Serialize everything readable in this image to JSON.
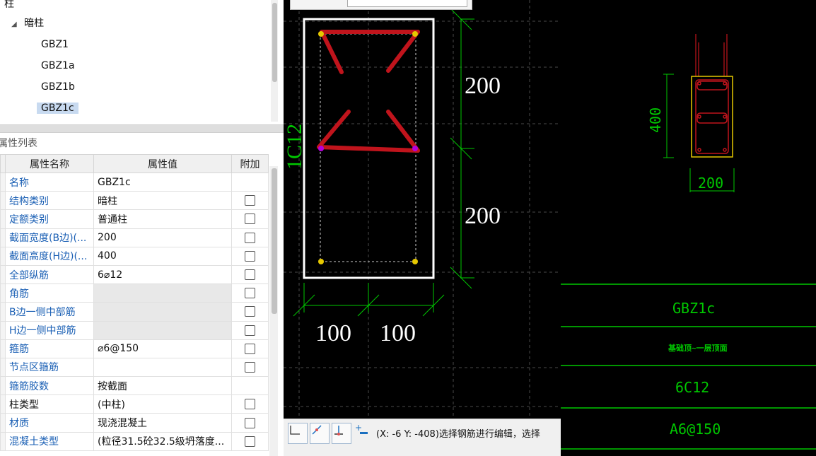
{
  "tree": {
    "root_label": "柱",
    "group_label": "暗柱",
    "items": [
      "GBZ1",
      "GBZ1a",
      "GBZ1b",
      "GBZ1c"
    ],
    "selected": "GBZ1c"
  },
  "props": {
    "title": "属性列表",
    "headers": [
      "属性名称",
      "属性值",
      "附加"
    ],
    "rows": [
      {
        "name": "名称",
        "value": "GBZ1c",
        "has_check": false,
        "grey": false,
        "black": false
      },
      {
        "name": "结构类别",
        "value": "暗柱",
        "has_check": true,
        "grey": false,
        "black": false
      },
      {
        "name": "定额类别",
        "value": "普通柱",
        "has_check": true,
        "grey": false,
        "black": false
      },
      {
        "name": "截面宽度(B边)(...",
        "value": "200",
        "has_check": true,
        "grey": false,
        "black": false
      },
      {
        "name": "截面高度(H边)(...",
        "value": "400",
        "has_check": true,
        "grey": false,
        "black": false
      },
      {
        "name": "全部纵筋",
        "value": "6⌀12",
        "has_check": true,
        "grey": false,
        "black": false
      },
      {
        "name": "角筋",
        "value": "",
        "has_check": true,
        "grey": true,
        "black": false
      },
      {
        "name": "B边一侧中部筋",
        "value": "",
        "has_check": true,
        "grey": true,
        "black": false
      },
      {
        "name": "H边一侧中部筋",
        "value": "",
        "has_check": true,
        "grey": true,
        "black": false
      },
      {
        "name": "箍筋",
        "value": "⌀6@150",
        "has_check": true,
        "grey": false,
        "black": false
      },
      {
        "name": "节点区箍筋",
        "value": "",
        "has_check": true,
        "grey": false,
        "black": false
      },
      {
        "name": "箍筋胶数",
        "value": "按截面",
        "has_check": false,
        "grey": false,
        "black": false
      },
      {
        "name": "柱类型",
        "value": "(中柱)",
        "has_check": true,
        "grey": false,
        "black": true
      },
      {
        "name": "材质",
        "value": "现浇混凝土",
        "has_check": true,
        "grey": false,
        "black": false
      },
      {
        "name": "混凝土类型",
        "value": "(粒径31.5砼32.5级坍落度...",
        "has_check": true,
        "grey": false,
        "black": false
      }
    ]
  },
  "canvas": {
    "dim_height_1": "200",
    "dim_height_2": "200",
    "dim_width_1": "100",
    "dim_width_2": "100",
    "side_label": "1C12",
    "status": "(X: -6 Y: -408)选择钢筋进行编辑，选择",
    "colors": {
      "background": "#000000",
      "rebar": "#c0141c",
      "outline": "#ffffff",
      "dim": "#00c800"
    }
  },
  "section_table": {
    "col_height": "400",
    "col_width": "200",
    "row_name": "GBZ1c",
    "row_elev": "基础顶~一层顶面",
    "row_rebar": "6C12",
    "row_stirrup": "A6@150"
  }
}
